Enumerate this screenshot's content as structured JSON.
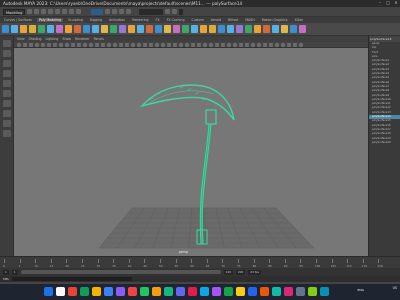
{
  "window": {
    "title": "Autodesk MAYA 2023: C:\\Users\\ryanb\\OneDrive\\Documents\\maya\\projects\\default\\scenes\\M11... --- polySurface14",
    "controls": [
      "–",
      "□",
      "✕"
    ]
  },
  "statusline": {
    "mode": "Modeling",
    "selection": "",
    "search_placeholder": "",
    "td": ""
  },
  "shelf_tabs": [
    "Curves / Surfaces",
    "Poly Modeling",
    "Sculpting",
    "Rigging",
    "Animation",
    "Rendering",
    "FX",
    "FX Caching",
    "Custom",
    "Arnold",
    "Bifrost",
    "MASH",
    "Motion Graphics",
    "XGen"
  ],
  "shelf_tabs_active_index": 1,
  "shelf_icon_colors": [
    "#3d8fd1",
    "#58b0e6",
    "#e8a33a",
    "#d8ad3a",
    "#3fa66a",
    "#58b0e6",
    "#c46fc1",
    "#e8a33a",
    "#d16b3d",
    "#3d8fd1",
    "#58b0e6",
    "#e0b64d",
    "#3fa66a",
    "#9c76d6",
    "#e8a33a",
    "#58b0e6",
    "#d16b3d",
    "#3d8fd1",
    "#e0b64d",
    "#c46fc1",
    "#3fa66a",
    "#58b0e6",
    "#e8a33a",
    "#d8ad3a",
    "#3d8fd1",
    "#58b0e6",
    "#9c76d6",
    "#3fa66a",
    "#e8a33a",
    "#d16b3d",
    "#58b0e6",
    "#e0b64d",
    "#3d8fd1",
    "#c46fc1"
  ],
  "panel_menu": [
    "View",
    "Shading",
    "Lighting",
    "Show",
    "Renderer",
    "Panels"
  ],
  "viewport": {
    "camera": "persp",
    "wireframe_color": "#3dd8a0",
    "background": "#777777",
    "grid_color": "#5e5e5e"
  },
  "outliner": {
    "header": "polySurface14",
    "items": [
      "persp",
      "top",
      "front",
      "side",
      "polySurface1",
      "polySurface2",
      "polySurface3",
      "polySurface4",
      "polySurface5",
      "polySurface6",
      "polySurface7",
      "polySurface8",
      "polySurface9",
      "polySurface10",
      "polySurface11",
      "polySurface12",
      "polySurface13",
      "polySurface14",
      "polySurface15",
      "polySurface16",
      "polySurface17",
      "polySurface18",
      "polySurface19",
      "polySurface20"
    ],
    "selected_index": 17
  },
  "timeslider": {
    "ticks": [
      "0",
      "5",
      "10",
      "15",
      "20",
      "25",
      "30",
      "35",
      "40",
      "45",
      "50",
      "55",
      "60",
      "65",
      "70",
      "75",
      "80",
      "85",
      "90",
      "95",
      "100",
      "105",
      "110",
      "115",
      "120"
    ],
    "current_frame": "1"
  },
  "range": {
    "start": "1",
    "playback_start": "1",
    "playback_end": "120",
    "end": "200",
    "fps": "24 fps"
  },
  "cmdline": {
    "lang": "MEL"
  },
  "taskbar": {
    "app_icon_colors": [
      "#1a73e8",
      "#ffffff",
      "#ea4335",
      "#0f9d58",
      "#f4b400",
      "#3b82f6",
      "#8b5cf6",
      "#ef4444",
      "#22c55e",
      "#f59e0b",
      "#10b981",
      "#6366f1",
      "#e11d48",
      "#0ea5e9",
      "#a855f7",
      "#16a34a",
      "#facc15",
      "#2563eb",
      "#ea580c",
      "#14b8a6",
      "#db2777",
      "#64748b",
      "#84cc16",
      "#0891b2"
    ],
    "lang_line1": "ENG",
    "lang_line2": "US"
  }
}
